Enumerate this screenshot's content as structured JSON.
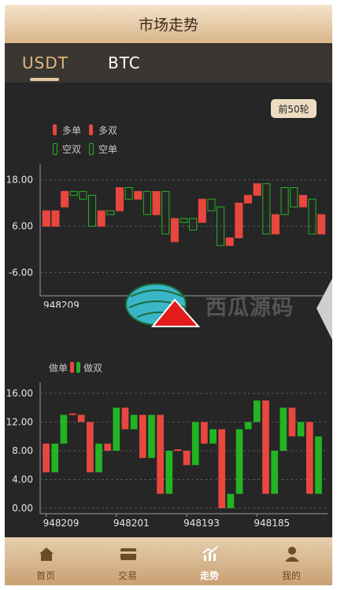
{
  "header": {
    "title": "市场走势"
  },
  "tabs": [
    {
      "label": "USDT",
      "active": true
    },
    {
      "label": "BTC",
      "active": false
    }
  ],
  "range_button": "前50轮",
  "legend_top": {
    "items": [
      "多单",
      "多双",
      "空双",
      "空单"
    ]
  },
  "legend_bottom": {
    "left": "做单",
    "right": "做双"
  },
  "colors": {
    "up": "#e8473f",
    "down": "#22b422",
    "gold": "#e3b67c"
  },
  "chart_data": [
    {
      "type": "candlestick",
      "y_ticks": [
        "18.00",
        "6.00",
        "-6.00"
      ],
      "y_tick_values": [
        18,
        6,
        -6
      ],
      "ylim": [
        -12,
        22
      ],
      "x_tick_labels": [
        "948209"
      ],
      "candles": [
        {
          "open": 10,
          "close": 6,
          "color": "up"
        },
        {
          "open": 6,
          "close": 10,
          "color": "up"
        },
        {
          "open": 11,
          "close": 15,
          "color": "up"
        },
        {
          "open": 15,
          "close": 14,
          "color": "down"
        },
        {
          "open": 15,
          "close": 13,
          "color": "down"
        },
        {
          "open": 14,
          "close": 6,
          "color": "down"
        },
        {
          "open": 10,
          "close": 6,
          "color": "up"
        },
        {
          "open": 10,
          "close": 9,
          "color": "down"
        },
        {
          "open": 10,
          "close": 16,
          "color": "up"
        },
        {
          "open": 16,
          "close": 13,
          "color": "down"
        },
        {
          "open": 13,
          "close": 15,
          "color": "up"
        },
        {
          "open": 15,
          "close": 9,
          "color": "down"
        },
        {
          "open": 9,
          "close": 15,
          "color": "up"
        },
        {
          "open": 15,
          "close": 4,
          "color": "down"
        },
        {
          "open": 8,
          "close": 2,
          "color": "up"
        },
        {
          "open": 8,
          "close": 7,
          "color": "down"
        },
        {
          "open": 8,
          "close": 5,
          "color": "down"
        },
        {
          "open": 7,
          "close": 13,
          "color": "up"
        },
        {
          "open": 13,
          "close": 10,
          "color": "down"
        },
        {
          "open": 11,
          "close": 1,
          "color": "down"
        },
        {
          "open": 1,
          "close": 3,
          "color": "up"
        },
        {
          "open": 3,
          "close": 12,
          "color": "up"
        },
        {
          "open": 12,
          "close": 14,
          "color": "up"
        },
        {
          "open": 14,
          "close": 17,
          "color": "up"
        },
        {
          "open": 17,
          "close": 4,
          "color": "down"
        },
        {
          "open": 4,
          "close": 9,
          "color": "up"
        },
        {
          "open": 9,
          "close": 16,
          "color": "down"
        },
        {
          "open": 16,
          "close": 11,
          "color": "down"
        },
        {
          "open": 11,
          "close": 14,
          "color": "up"
        },
        {
          "open": 13,
          "close": 4,
          "color": "down"
        },
        {
          "open": 9,
          "close": 4,
          "color": "up"
        }
      ]
    },
    {
      "type": "bar",
      "y_ticks": [
        "16.00",
        "12.00",
        "8.00",
        "4.00",
        "0.00"
      ],
      "y_tick_values": [
        16,
        12,
        8,
        4,
        0
      ],
      "ylim": [
        0,
        16
      ],
      "x_tick_labels": [
        "948209",
        "948201",
        "948193",
        "948185"
      ],
      "bars": [
        {
          "low": 5,
          "high": 9,
          "color": "up"
        },
        {
          "low": 5,
          "high": 9,
          "color": "down"
        },
        {
          "low": 9,
          "high": 13,
          "color": "down"
        },
        {
          "low": 13,
          "high": 13.2,
          "color": "up"
        },
        {
          "low": 12,
          "high": 13,
          "color": "up"
        },
        {
          "low": 5,
          "high": 12,
          "color": "up"
        },
        {
          "low": 5,
          "high": 9,
          "color": "down"
        },
        {
          "low": 8,
          "high": 9,
          "color": "up"
        },
        {
          "low": 8,
          "high": 14,
          "color": "down"
        },
        {
          "low": 11,
          "high": 14,
          "color": "up"
        },
        {
          "low": 11,
          "high": 13,
          "color": "down"
        },
        {
          "low": 7,
          "high": 13,
          "color": "up"
        },
        {
          "low": 7,
          "high": 13,
          "color": "down"
        },
        {
          "low": 2,
          "high": 13,
          "color": "up"
        },
        {
          "low": 2,
          "high": 8,
          "color": "down"
        },
        {
          "low": 8,
          "high": 8.2,
          "color": "up"
        },
        {
          "low": 6,
          "high": 8,
          "color": "up"
        },
        {
          "low": 6,
          "high": 12,
          "color": "down"
        },
        {
          "low": 9,
          "high": 12,
          "color": "up"
        },
        {
          "low": 9,
          "high": 11,
          "color": "down"
        },
        {
          "low": 0,
          "high": 11,
          "color": "up"
        },
        {
          "low": 0,
          "high": 2,
          "color": "down"
        },
        {
          "low": 2,
          "high": 11,
          "color": "down"
        },
        {
          "low": 11,
          "high": 12,
          "color": "down"
        },
        {
          "low": 12,
          "high": 15,
          "color": "down"
        },
        {
          "low": 2,
          "high": 15,
          "color": "up"
        },
        {
          "low": 2,
          "high": 8,
          "color": "down"
        },
        {
          "low": 8,
          "high": 14,
          "color": "down"
        },
        {
          "low": 10,
          "high": 14,
          "color": "up"
        },
        {
          "low": 10,
          "high": 12,
          "color": "down"
        },
        {
          "low": 2,
          "high": 12,
          "color": "up"
        },
        {
          "low": 2,
          "high": 10,
          "color": "down"
        }
      ]
    }
  ],
  "watermark": {
    "text": "西瓜源码"
  },
  "nav": [
    {
      "label": "首页",
      "icon": "home-icon",
      "active": false
    },
    {
      "label": "交易",
      "icon": "card-icon",
      "active": false
    },
    {
      "label": "走势",
      "icon": "trend-chart-icon",
      "active": true
    },
    {
      "label": "我的",
      "icon": "user-icon",
      "active": false
    }
  ]
}
